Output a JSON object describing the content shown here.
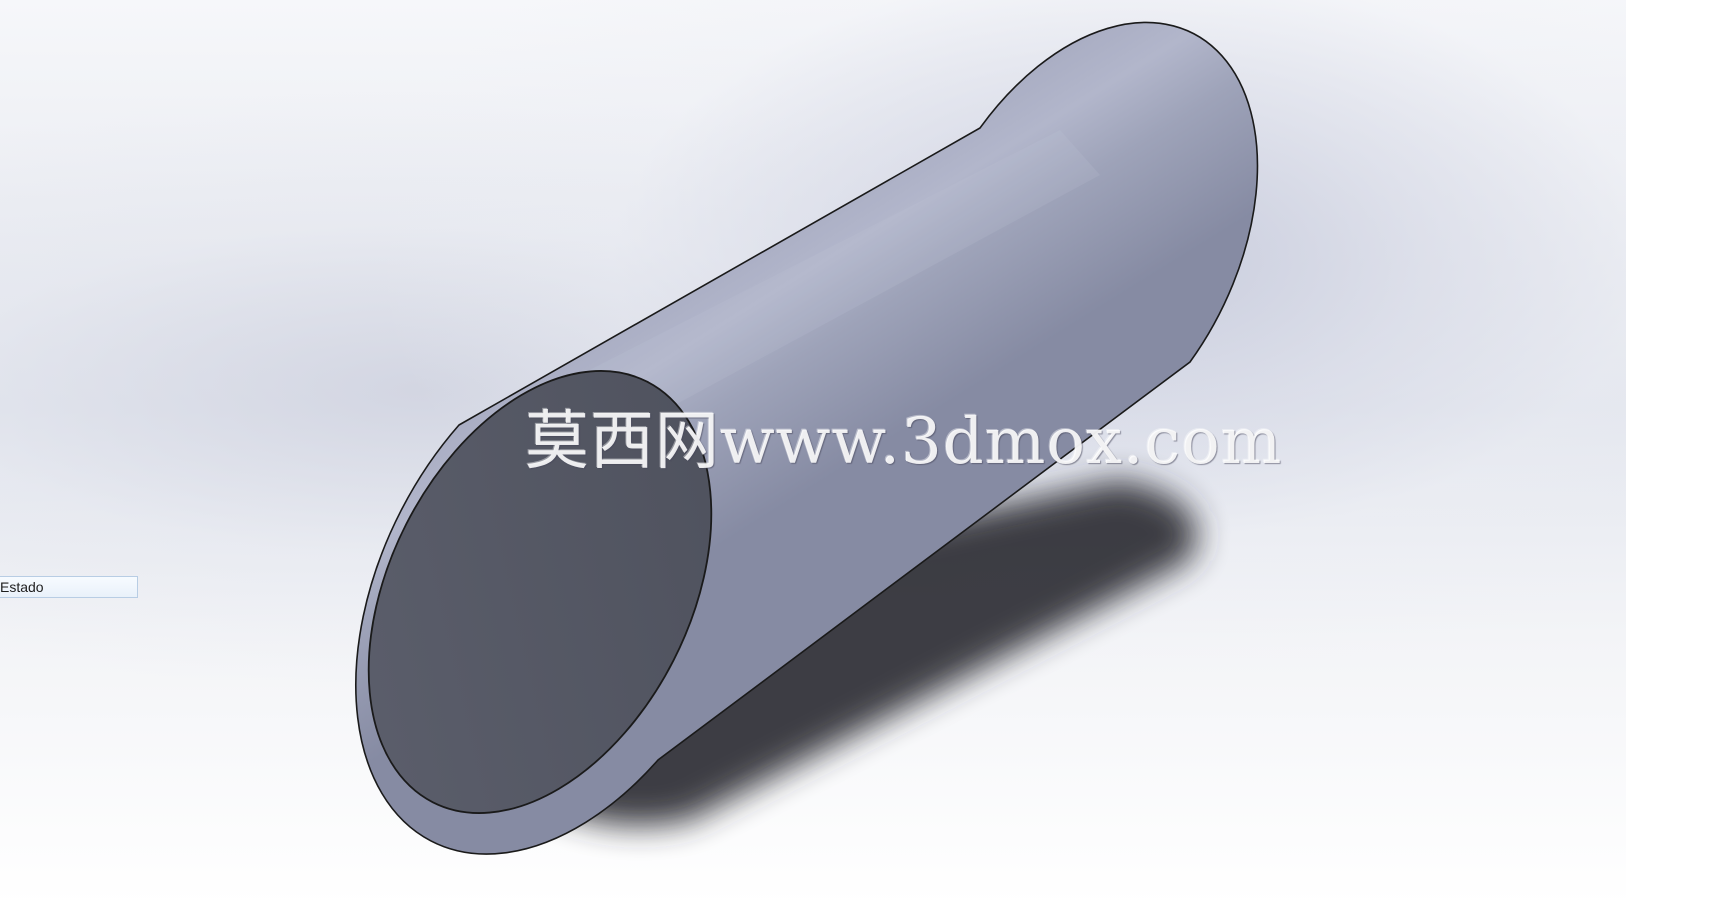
{
  "viewport": {
    "model": {
      "shape": "cylinder",
      "end_cap_color": "#535663",
      "body_color": "#9a9eb4",
      "highlight_color": "#b4b8cc",
      "edge_color": "#1a1a1a"
    },
    "watermark": {
      "text": "莫西网www.3dmox.com"
    },
    "background": {
      "top_color": "#f4f5f8",
      "mid_color": "#e3e6ee",
      "bottom_color": "#ffffff"
    }
  },
  "status_field": {
    "label": "Estado"
  }
}
